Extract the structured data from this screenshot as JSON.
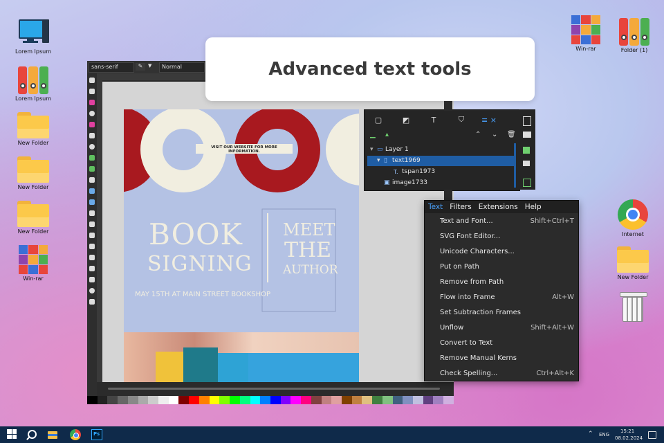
{
  "banner": {
    "title": "Advanced text tools"
  },
  "desktop_left": [
    {
      "label": "Lorem Ipsum",
      "icon": "computer-icon"
    },
    {
      "label": "Lorem Ipsum",
      "icon": "binders-icon"
    },
    {
      "label": "New Folder",
      "icon": "folder-icon"
    },
    {
      "label": "New Folder",
      "icon": "folder-icon"
    },
    {
      "label": "New Folder",
      "icon": "folder-icon"
    },
    {
      "label": "Win-rar",
      "icon": "winrar-icon"
    }
  ],
  "desktop_right": [
    {
      "label": "Win-rar",
      "icon": "winrar-icon"
    },
    {
      "label": "Folder (1)",
      "icon": "binders-icon"
    },
    {
      "label": "Internet",
      "icon": "chrome-icon"
    },
    {
      "label": "New Folder",
      "icon": "folder-icon"
    },
    {
      "label": "",
      "icon": "recycle-bin-icon"
    }
  ],
  "toolbar": {
    "font_family": "sans-serif",
    "font_style": "Normal"
  },
  "poster": {
    "top_text": "VISIT OUR WEBSITE FOR MORE INFORMATION.",
    "book_line1": "BOOK",
    "book_line2": "SIGNING",
    "meet_line1": "MEET",
    "meet_line2": "THE",
    "meet_line3": "AUTHOR",
    "date_line": "MAY 15TH AT MAIN STREET BOOKSHOP",
    "colors": {
      "bg": "#b4c2e4",
      "red": "#a8191f",
      "cream": "#f1eee0",
      "text": "#f1eee0"
    }
  },
  "layers": {
    "tab_icons": [
      "fill-stroke-icon",
      "edit-icon",
      "text-icon",
      "shield-icon",
      "layers-icon",
      "close-icon"
    ],
    "rows": [
      {
        "label": "Layer 1",
        "indent": 0,
        "selected": false
      },
      {
        "label": "text1969",
        "indent": 1,
        "selected": true
      },
      {
        "label": "tspan1973",
        "indent": 2,
        "selected": false
      },
      {
        "label": "image1733",
        "indent": 1,
        "selected": false
      }
    ]
  },
  "menu": {
    "bar": [
      "Text",
      "Filters",
      "Extensions",
      "Help"
    ],
    "items": [
      {
        "label": "Text and Font...",
        "shortcut": "Shift+Ctrl+T"
      },
      {
        "label": "SVG Font Editor...",
        "shortcut": ""
      },
      {
        "label": "Unicode Characters...",
        "shortcut": ""
      },
      {
        "label": "Put on Path",
        "shortcut": ""
      },
      {
        "label": "Remove from Path",
        "shortcut": ""
      },
      {
        "label": "Flow into Frame",
        "shortcut": "Alt+W"
      },
      {
        "label": "Set Subtraction Frames",
        "shortcut": ""
      },
      {
        "label": "Unflow",
        "shortcut": "Shift+Alt+W"
      },
      {
        "label": "Convert to Text",
        "shortcut": ""
      },
      {
        "label": "Remove Manual Kerns",
        "shortcut": ""
      },
      {
        "label": "Check Spelling...",
        "shortcut": "Ctrl+Alt+K"
      }
    ]
  },
  "taskbar": {
    "lang": "ENG",
    "time": "15:21",
    "date": "08.02.2024",
    "ps_label": "Ps"
  },
  "accent": "#4aa3ff"
}
